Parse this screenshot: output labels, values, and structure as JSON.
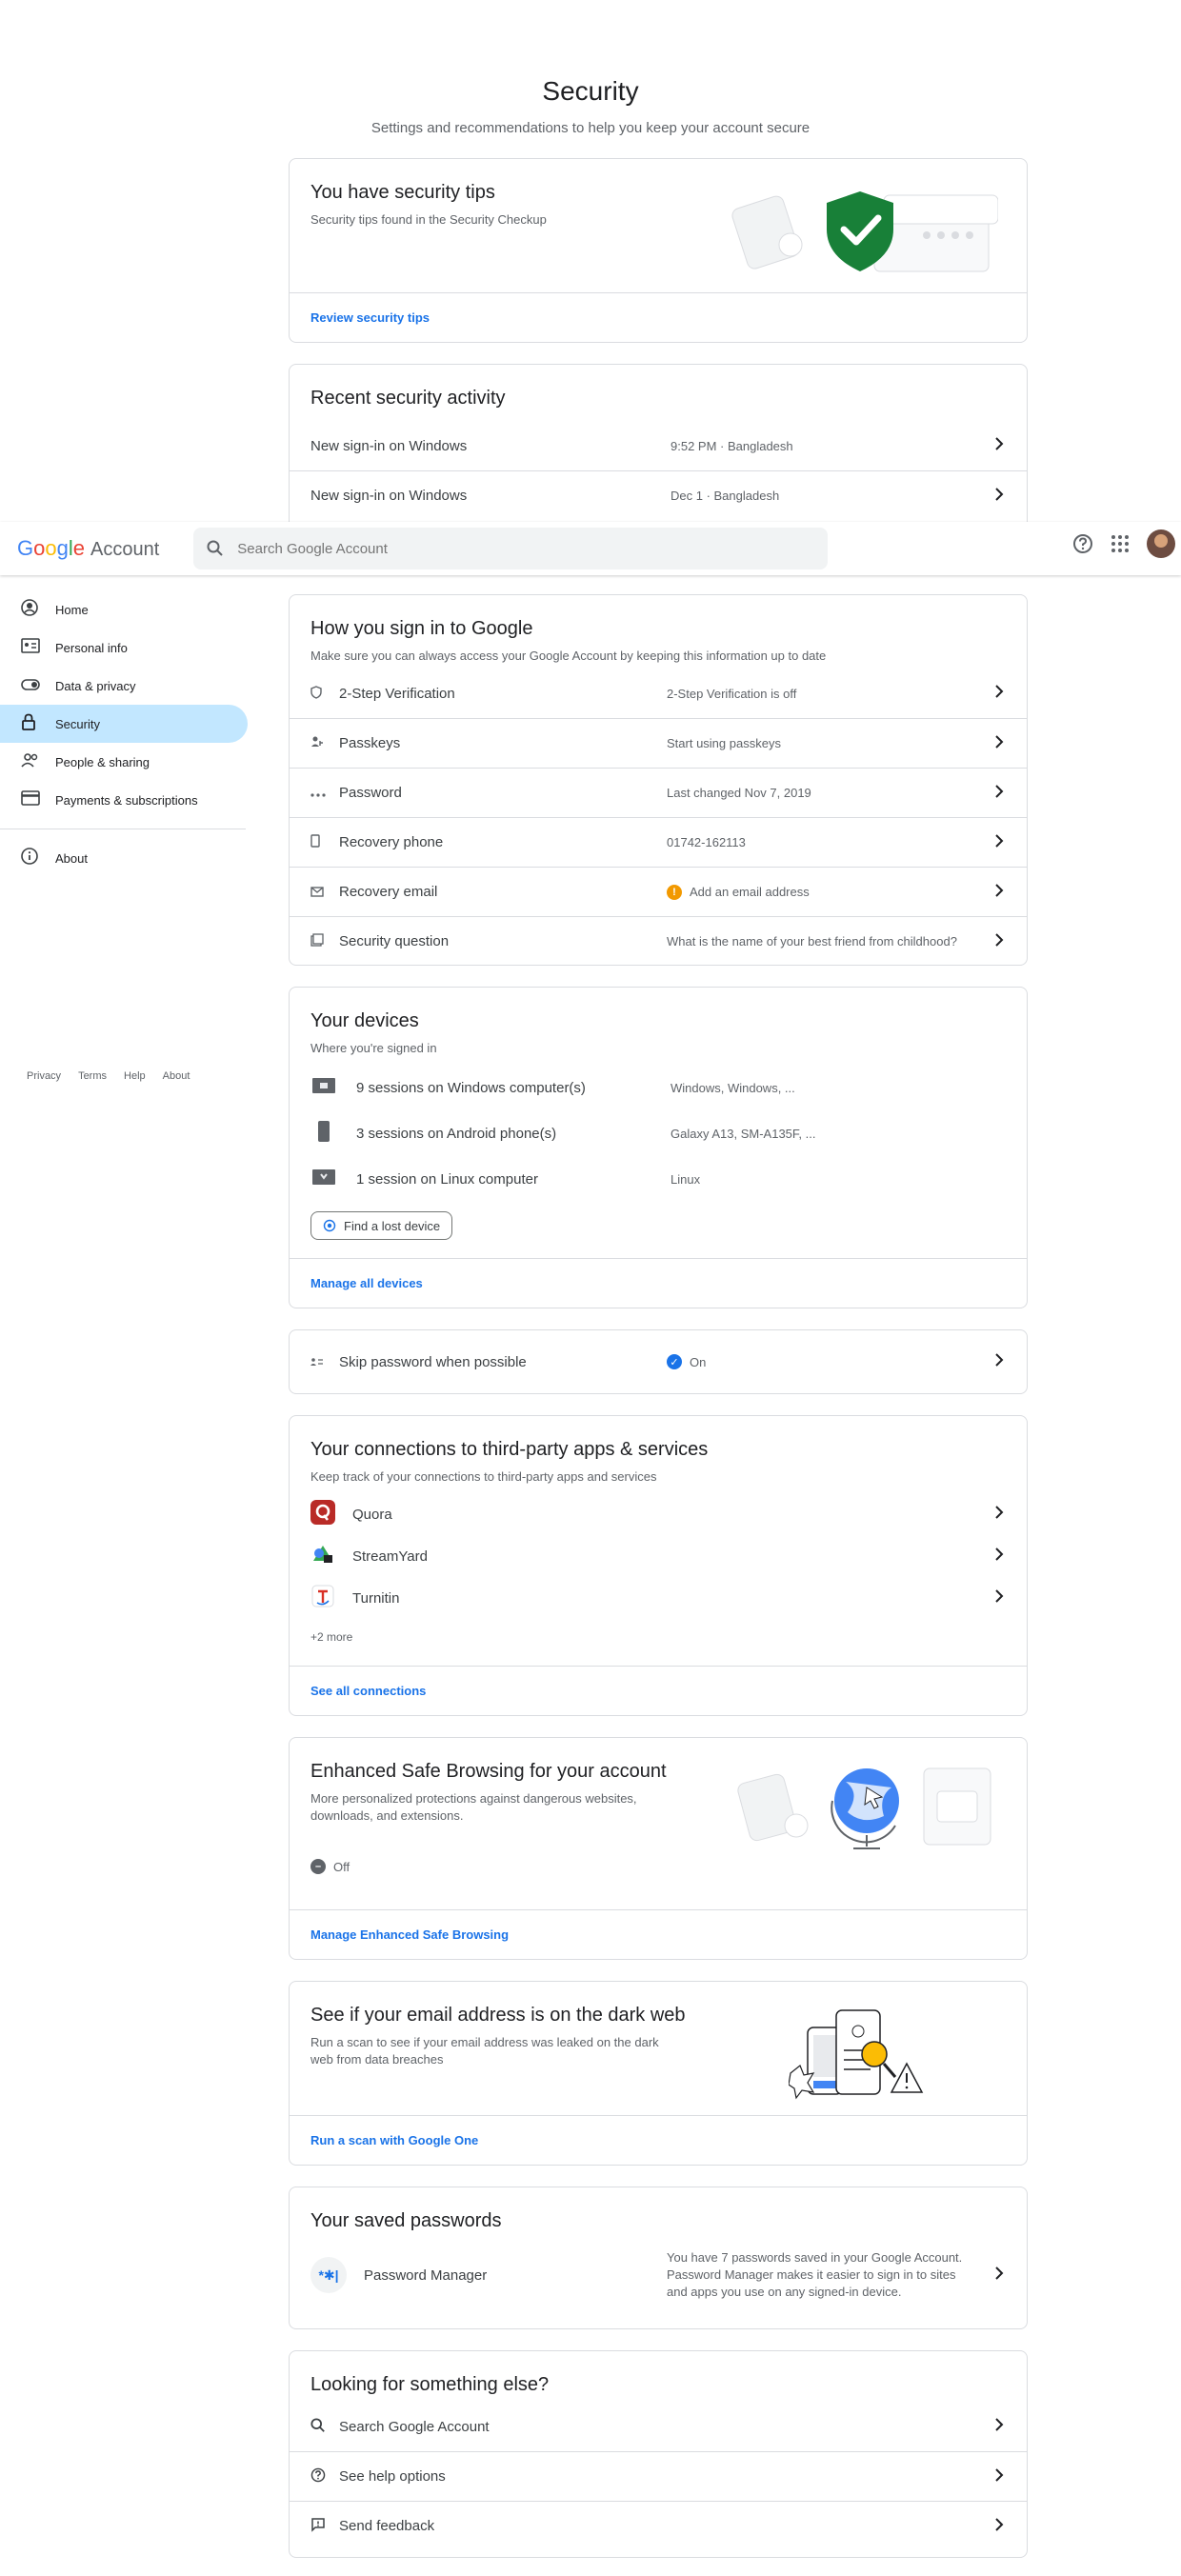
{
  "header": {
    "title": "Security",
    "subtitle": "Settings and recommendations to help you keep your account secure"
  },
  "tips": {
    "title": "You have security tips",
    "desc": "Security tips found in the Security Checkup",
    "link": "Review security tips"
  },
  "activity": {
    "title": "Recent security activity",
    "rows": [
      {
        "label": "New sign-in on Windows",
        "value": "9:52 PM · Bangladesh"
      },
      {
        "label": "New sign-in on Windows",
        "value": "Dec 1 · Bangladesh"
      }
    ]
  },
  "topbar": {
    "logo_g": "G",
    "logo_o1": "o",
    "logo_o2": "o",
    "logo_g2": "g",
    "logo_l": "l",
    "logo_e": "e",
    "logo_account": "Account",
    "search_placeholder": "Search Google Account"
  },
  "sidebar": {
    "items": [
      {
        "label": "Home",
        "icon": "home-icon"
      },
      {
        "label": "Personal info",
        "icon": "id-card-icon"
      },
      {
        "label": "Data & privacy",
        "icon": "toggle-icon"
      },
      {
        "label": "Security",
        "icon": "lock-icon"
      },
      {
        "label": "People & sharing",
        "icon": "people-icon"
      },
      {
        "label": "Payments & subscriptions",
        "icon": "card-icon"
      },
      {
        "label": "About",
        "icon": "info-icon"
      }
    ],
    "footer": [
      "Privacy",
      "Terms",
      "Help",
      "About"
    ]
  },
  "signin": {
    "title": "How you sign in to Google",
    "desc": "Make sure you can always access your Google Account by keeping this information up to date",
    "rows": [
      {
        "label": "2-Step Verification",
        "value": "2-Step Verification is off"
      },
      {
        "label": "Passkeys",
        "value": "Start using passkeys"
      },
      {
        "label": "Password",
        "value": "Last changed Nov 7, 2019"
      },
      {
        "label": "Recovery phone",
        "value": "01742-162113"
      },
      {
        "label": "Recovery email",
        "value": "Add an email address"
      },
      {
        "label": "Security question",
        "value": "What is the name of your best friend from childhood?"
      }
    ]
  },
  "devices": {
    "title": "Your devices",
    "desc": "Where you're signed in",
    "rows": [
      {
        "label": "9 sessions on Windows computer(s)",
        "value": "Windows, Windows, ..."
      },
      {
        "label": "3 sessions on Android phone(s)",
        "value": "Galaxy A13, SM-A135F, ..."
      },
      {
        "label": "1 session on Linux computer",
        "value": "Linux"
      }
    ],
    "find_button": "Find a lost device",
    "link": "Manage all devices"
  },
  "skip_password": {
    "label": "Skip password when possible",
    "value": "On"
  },
  "connections": {
    "title": "Your connections to third-party apps & services",
    "desc": "Keep track of your connections to third-party apps and services",
    "apps": [
      {
        "label": "Quora",
        "color": "#b92b27"
      },
      {
        "label": "StreamYard",
        "color": "#34a853"
      },
      {
        "label": "Turnitin",
        "color": "#d93025"
      }
    ],
    "more": "+2 more",
    "link": "See all connections"
  },
  "safe_browsing": {
    "title": "Enhanced Safe Browsing for your account",
    "desc": "More personalized protections against dangerous websites, downloads, and extensions.",
    "status": "Off",
    "link": "Manage Enhanced Safe Browsing"
  },
  "dark_web": {
    "title": "See if your email address is on the dark web",
    "desc": "Run a scan to see if your email address was leaked on the dark web from data breaches",
    "link": "Run a scan with Google One"
  },
  "passwords": {
    "title": "Your saved passwords",
    "label": "Password Manager",
    "icon_text": "*✱|",
    "value": "You have 7 passwords saved in your Google Account. Password Manager makes it easier to sign in to sites and apps you use on any signed-in device."
  },
  "else": {
    "title": "Looking for something else?",
    "rows": [
      {
        "label": "Search Google Account"
      },
      {
        "label": "See help options"
      },
      {
        "label": "Send feedback"
      }
    ]
  },
  "colors": {
    "accent": "#1a73e8",
    "active_nav": "#c2e7ff",
    "warning": "#f29900",
    "shield": "#188038"
  }
}
